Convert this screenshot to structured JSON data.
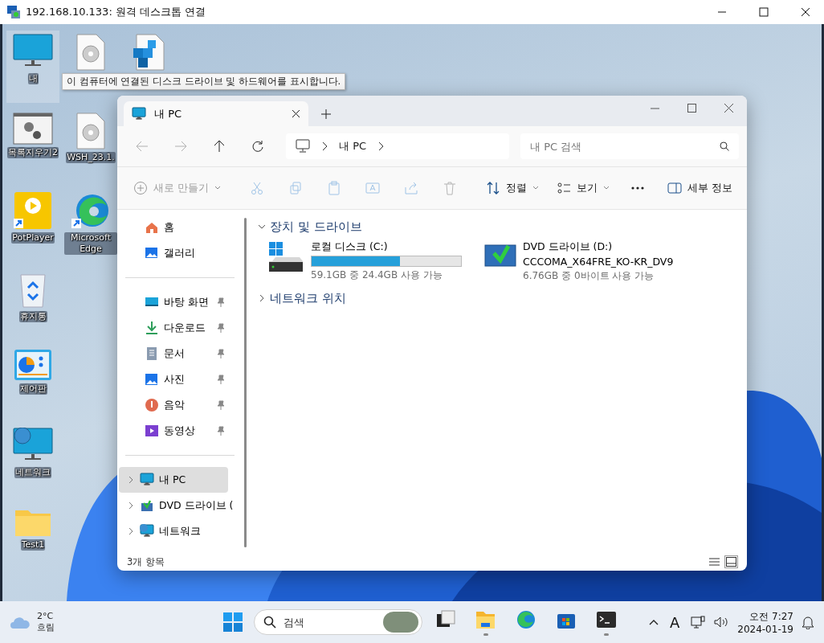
{
  "rdp_window": {
    "title": "192.168.10.133: 원격 데스크톱 연결"
  },
  "desktop": {
    "columns": [
      {
        "icons": [
          {
            "label": "내",
            "selected": true
          },
          {
            "label": "목록지우기2",
            "selected": false
          },
          {
            "label": "PotPlayer",
            "selected": false
          },
          {
            "label": "휴지통",
            "selected": false
          },
          {
            "label": "제어판",
            "selected": false
          },
          {
            "label": "네트워크",
            "selected": false
          },
          {
            "label": "Test1",
            "selected": false
          }
        ]
      },
      {
        "icons": [
          {
            "selected": false
          },
          {
            "label": "WSH_23.1.",
            "selected": false
          },
          {
            "label": "Microsoft Edge",
            "selected": false
          }
        ]
      },
      {
        "icons": [
          {
            "selected": false
          }
        ]
      }
    ],
    "tooltip": "이 컴퓨터에 연결된 디스크 드라이브 및 하드웨어를 표시합니다."
  },
  "explorer": {
    "tabs": [
      {
        "label": "내 PC",
        "selected": true
      }
    ],
    "address": {
      "path": [
        "내 PC"
      ]
    },
    "search": {
      "placeholder": "내 PC 검색"
    },
    "nav_buttons": [
      {
        "disabled": true
      },
      {
        "disabled": true
      },
      {
        "disabled": false
      },
      {
        "disabled": false
      }
    ],
    "toolbar": [
      {
        "label": "새로 만들기",
        "disabled": true,
        "dropdown": true
      },
      {
        "disabled": true
      },
      {
        "disabled": true
      },
      {
        "disabled": true
      },
      {
        "disabled": true
      },
      {
        "disabled": true
      },
      {
        "disabled": true
      },
      {
        "label": "정렬",
        "disabled": false,
        "dropdown": true
      },
      {
        "label": "보기",
        "disabled": false,
        "dropdown": true
      },
      {
        "disabled": false
      },
      {
        "label": "세부 정보",
        "disabled": false
      }
    ],
    "sidebar": {
      "sections": [
        {
          "items": [
            {
              "label": "홈",
              "selected": false
            },
            {
              "label": "갤러리",
              "selected": false
            }
          ]
        },
        {
          "items": [
            {
              "label": "바탕 화면",
              "selected": false,
              "pinned": true
            },
            {
              "label": "다운로드",
              "selected": false,
              "pinned": true
            },
            {
              "label": "문서",
              "selected": false,
              "pinned": true
            },
            {
              "label": "사진",
              "selected": false,
              "pinned": true
            },
            {
              "label": "음악",
              "selected": false,
              "pinned": true
            },
            {
              "label": "동영상",
              "selected": false,
              "pinned": true
            }
          ]
        },
        {
          "items": [
            {
              "label": "내 PC",
              "selected": true,
              "expanded": false
            },
            {
              "label": "DVD 드라이브 (",
              "selected": false,
              "expanded": false
            },
            {
              "label": "네트워크",
              "selected": false,
              "expanded": false
            }
          ]
        }
      ]
    },
    "groups": [
      {
        "title": "장치 및 드라이브",
        "expanded": true,
        "drives": [
          {
            "kind": "disk",
            "name": "로컬 디스크 (C:)",
            "level": 0.59,
            "space": "59.1GB 중 24.4GB 사용 가능"
          },
          {
            "kind": "dvd",
            "name": "DVD 드라이브 (D:)",
            "volume": "CCCOMA_X64FRE_KO-KR_DV9",
            "space": "6.76GB 중 0바이트 사용 가능"
          }
        ]
      },
      {
        "title": "네트워크 위치",
        "expanded": false
      }
    ],
    "status": {
      "count": "3개 항목",
      "views": [
        {
          "selected": false
        },
        {
          "selected": true
        }
      ]
    }
  },
  "taskbar": {
    "weather": {
      "temp": "2°C",
      "condition": "흐림"
    },
    "search": {
      "placeholder": "검색"
    },
    "apps": [
      {
        "running": false
      },
      {
        "running": true
      },
      {
        "running": false
      },
      {
        "running": false
      },
      {
        "running": true
      }
    ],
    "tray": {
      "ime": "A",
      "time": "오전 7:27",
      "date": "2024-01-19"
    }
  }
}
